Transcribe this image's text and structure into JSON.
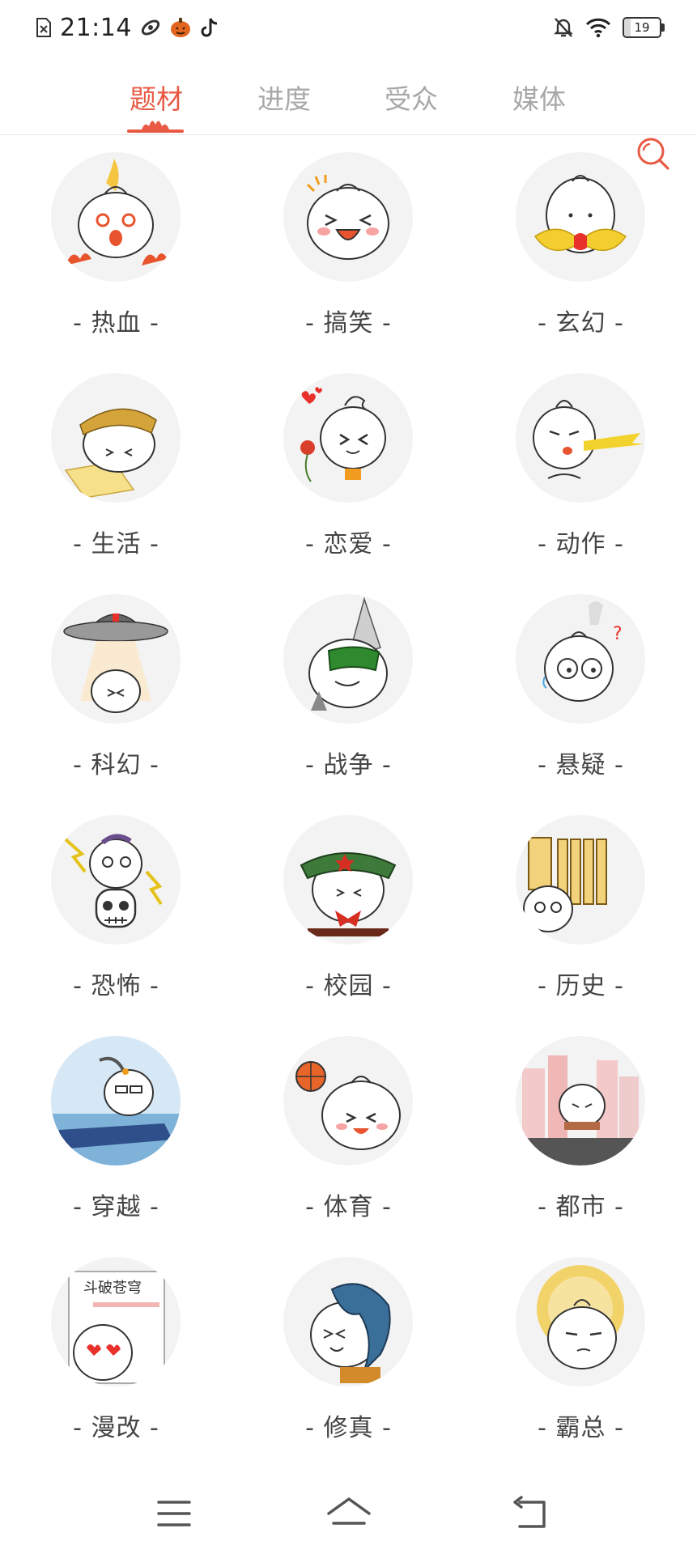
{
  "status_bar": {
    "time": "21:14",
    "battery_level": "19",
    "left_icons": [
      "sim-error-icon",
      "swirl-app-icon",
      "pumpkin-app-icon",
      "tiktok-icon"
    ],
    "right_icons": [
      "mute-bell-icon",
      "wifi-icon",
      "battery-icon"
    ]
  },
  "tabs": [
    {
      "label": "题材",
      "active": true
    },
    {
      "label": "进度",
      "active": false
    },
    {
      "label": "受众",
      "active": false
    },
    {
      "label": "媒体",
      "active": false
    }
  ],
  "accent_color": "#e85a44",
  "categories": [
    {
      "label": "- 热血 -",
      "icon": "fire-bun-icon"
    },
    {
      "label": "- 搞笑 -",
      "icon": "laughing-bun-icon"
    },
    {
      "label": "- 玄幻 -",
      "icon": "fantasy-bun-icon"
    },
    {
      "label": "- 生活 -",
      "icon": "life-bun-icon"
    },
    {
      "label": "- 恋爱 -",
      "icon": "love-bun-icon"
    },
    {
      "label": "- 动作 -",
      "icon": "action-bun-icon"
    },
    {
      "label": "- 科幻 -",
      "icon": "ufo-bun-icon"
    },
    {
      "label": "- 战争 -",
      "icon": "war-bun-icon"
    },
    {
      "label": "- 悬疑 -",
      "icon": "mystery-bun-icon"
    },
    {
      "label": "- 恐怖 -",
      "icon": "horror-bun-icon"
    },
    {
      "label": "- 校园 -",
      "icon": "campus-bun-icon"
    },
    {
      "label": "- 历史 -",
      "icon": "history-bun-icon"
    },
    {
      "label": "- 穿越 -",
      "icon": "time-travel-bun-icon"
    },
    {
      "label": "- 体育 -",
      "icon": "sports-bun-icon"
    },
    {
      "label": "- 都市 -",
      "icon": "city-bun-icon"
    },
    {
      "label": "- 漫改 -",
      "icon": "adaptation-bun-icon"
    },
    {
      "label": "- 修真 -",
      "icon": "cultivation-bun-icon"
    },
    {
      "label": "- 霸总 -",
      "icon": "ceo-bun-icon"
    }
  ],
  "nav_bar": {
    "buttons": [
      "menu-icon",
      "home-icon",
      "back-icon"
    ]
  }
}
